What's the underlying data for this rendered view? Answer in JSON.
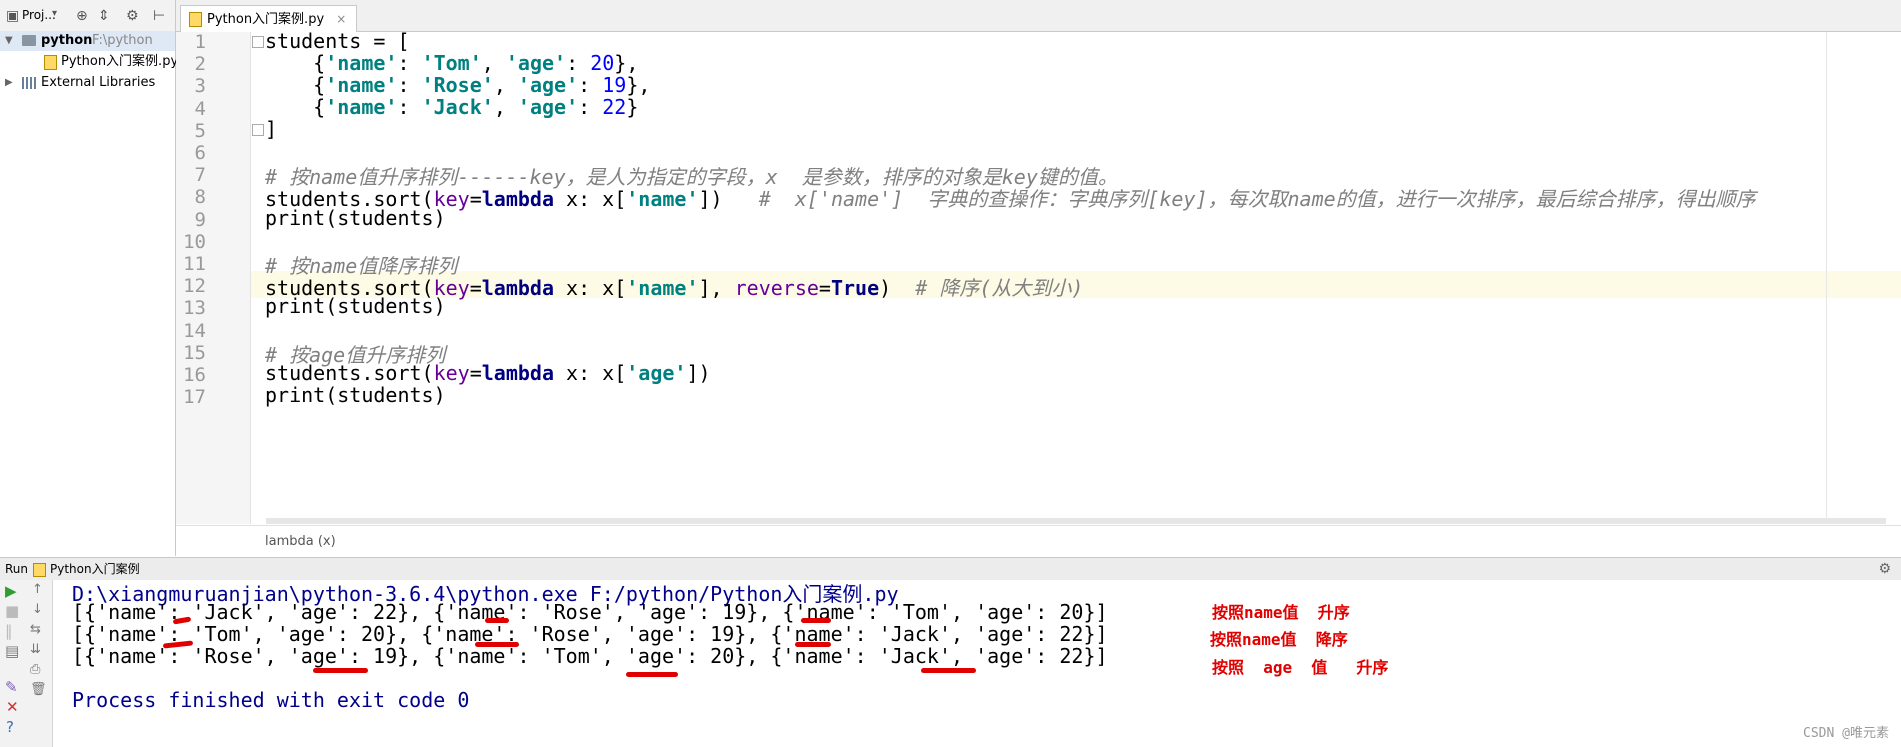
{
  "project": {
    "selector_label": "Proj...",
    "root_name": "python",
    "root_path": "F:\\python",
    "file_name": "Python入门案例.py",
    "libraries_label": "External Libraries"
  },
  "editor": {
    "tab_label": "Python入门案例.py",
    "tab_close": "×",
    "line_numbers": [
      "1",
      "2",
      "3",
      "4",
      "5",
      "6",
      "7",
      "8",
      "9",
      "10",
      "11",
      "12",
      "13",
      "14",
      "15",
      "16",
      "17"
    ],
    "current_line": 12,
    "breadcrumb": "lambda (x)"
  },
  "run": {
    "label": "Run",
    "config_name": "Python入门案例",
    "console": [
      "D:\\xiangmuruanjian\\python-3.6.4\\python.exe F:/python/Python入门案例.py",
      "[{'name': 'Jack', 'age': 22}, {'name': 'Rose', 'age': 19}, {'name': 'Tom', 'age': 20}]",
      "[{'name': 'Tom', 'age': 20}, {'name': 'Rose', 'age': 19}, {'name': 'Jack', 'age': 22}]",
      "[{'name': 'Rose', 'age': 19}, {'name': 'Tom', 'age': 20}, {'name': 'Jack', 'age': 22}]",
      "",
      "Process finished with exit code 0"
    ],
    "notes": [
      "按照name值  升序",
      "按照name值  降序",
      "按照  age  值   升序"
    ]
  },
  "watermark": "CSDN @唯元素",
  "colors": {
    "keyword": "#000080",
    "string": "#008080",
    "number": "#0000ff",
    "comment": "#808080",
    "annotation": "#e00000"
  }
}
